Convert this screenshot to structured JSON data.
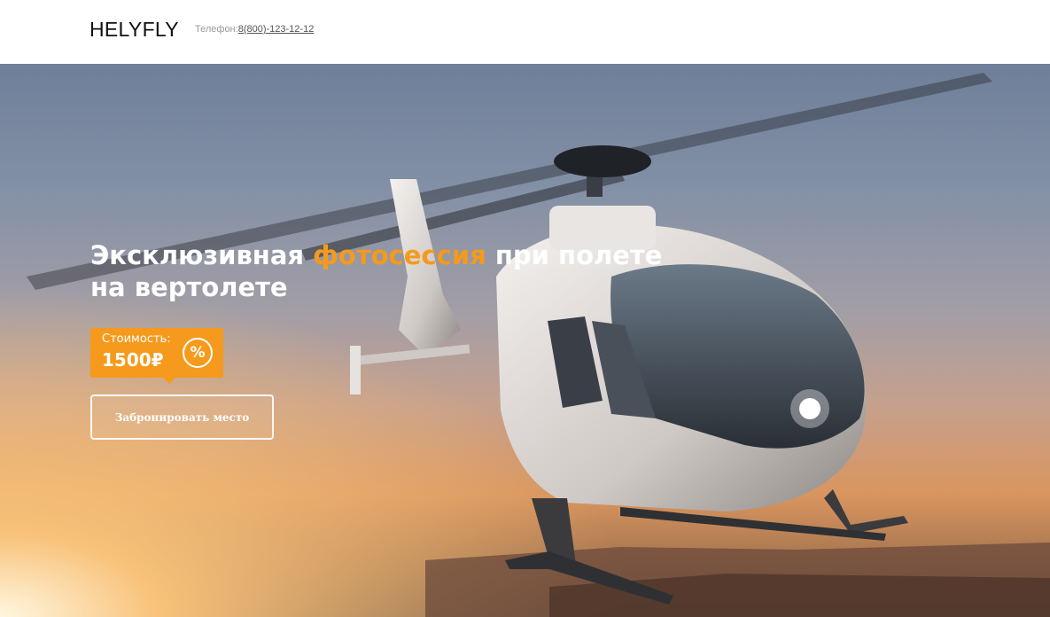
{
  "header": {
    "logo": "HELYFLY",
    "phone_label": "Телефон:",
    "phone_number": "8(800)-123-12-12"
  },
  "hero": {
    "headline_part1": "Эксклюзивная ",
    "headline_accent": "фотосессия",
    "headline_part2": " при полете на вертолете",
    "price_label": "Стоимость:",
    "price_value": "1500₽",
    "discount_symbol": "%",
    "book_button": "Забронировать место"
  },
  "colors": {
    "accent": "#f59a1c",
    "header_bg": "#ffffff",
    "text_light": "#ffffff"
  }
}
